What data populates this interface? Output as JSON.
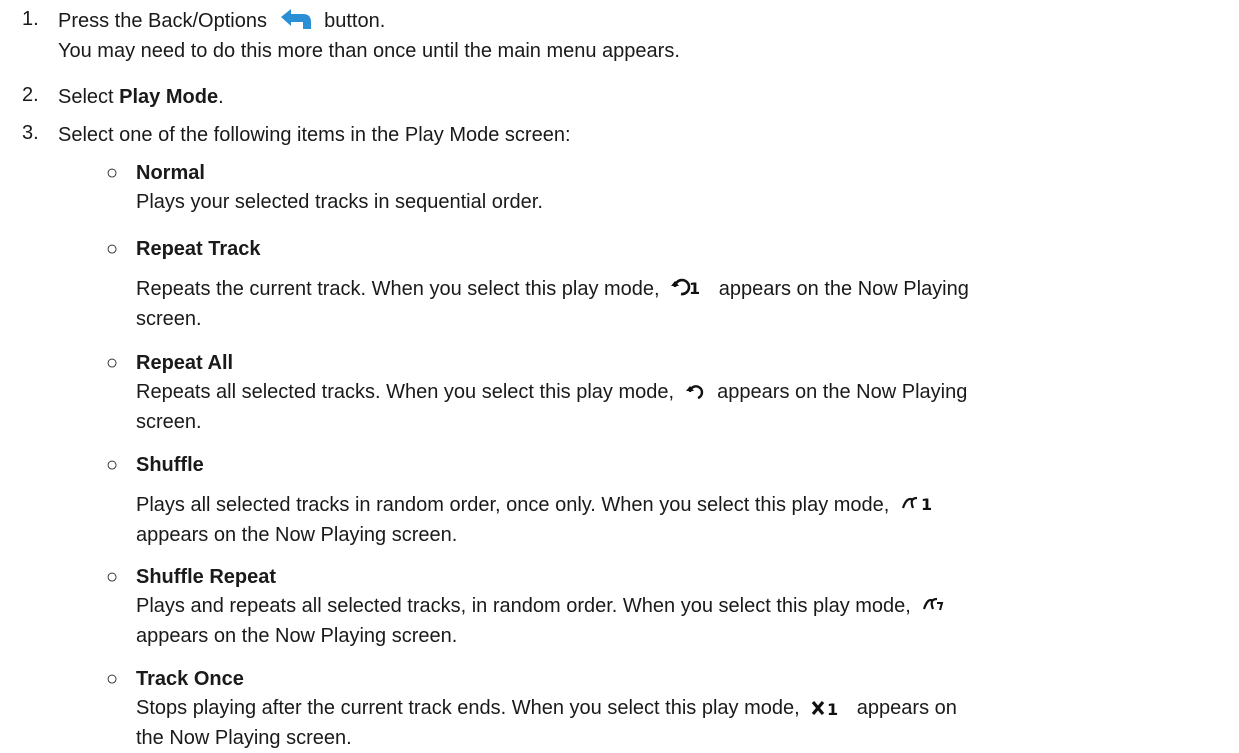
{
  "steps": [
    {
      "number": "1.",
      "text_before": "Press the Back/Options",
      "icon": "back-arrow-icon",
      "text_after": "button.",
      "line2": "You may need to do this more than once until the main menu appears."
    },
    {
      "number": "2.",
      "text_before": "Select ",
      "bold": "Play Mode",
      "text_after": "."
    },
    {
      "number": "3.",
      "text": "Select one of the following items in the Play Mode screen:"
    }
  ],
  "bullet": "○",
  "options": [
    {
      "title": "Normal",
      "desc": "Plays your selected tracks in sequential order."
    },
    {
      "title": "Repeat Track",
      "desc_before": "Repeats the current track. When you select this play mode,",
      "icon": "repeat-one-icon",
      "desc_after": "appears on the Now Playing",
      "desc_line2": "screen."
    },
    {
      "title": "Repeat All",
      "desc_before": "Repeats all selected tracks. When you select this play mode,",
      "icon": "repeat-all-icon",
      "desc_after": "appears on the Now Playing",
      "desc_line2": "screen."
    },
    {
      "title": "Shuffle",
      "desc_before": "Plays all selected tracks in random order, once only. When you select this play mode,",
      "icon": "shuffle-once-icon",
      "desc_line2": "appears on the Now Playing screen."
    },
    {
      "title": "Shuffle Repeat",
      "desc_before": "Plays and repeats all selected tracks, in random order. When you select this play mode,",
      "icon": "shuffle-repeat-icon",
      "desc_line2": "appears on the Now Playing screen."
    },
    {
      "title": "Track Once",
      "desc_before": "Stops playing after the current track ends. When you select this play mode,",
      "icon": "track-once-icon",
      "desc_after": "appears on",
      "desc_line2": "the Now Playing screen."
    }
  ],
  "colors": {
    "text": "#1a1a1a",
    "back_icon": "#2b8fd6",
    "mode_icon": "#111111"
  }
}
